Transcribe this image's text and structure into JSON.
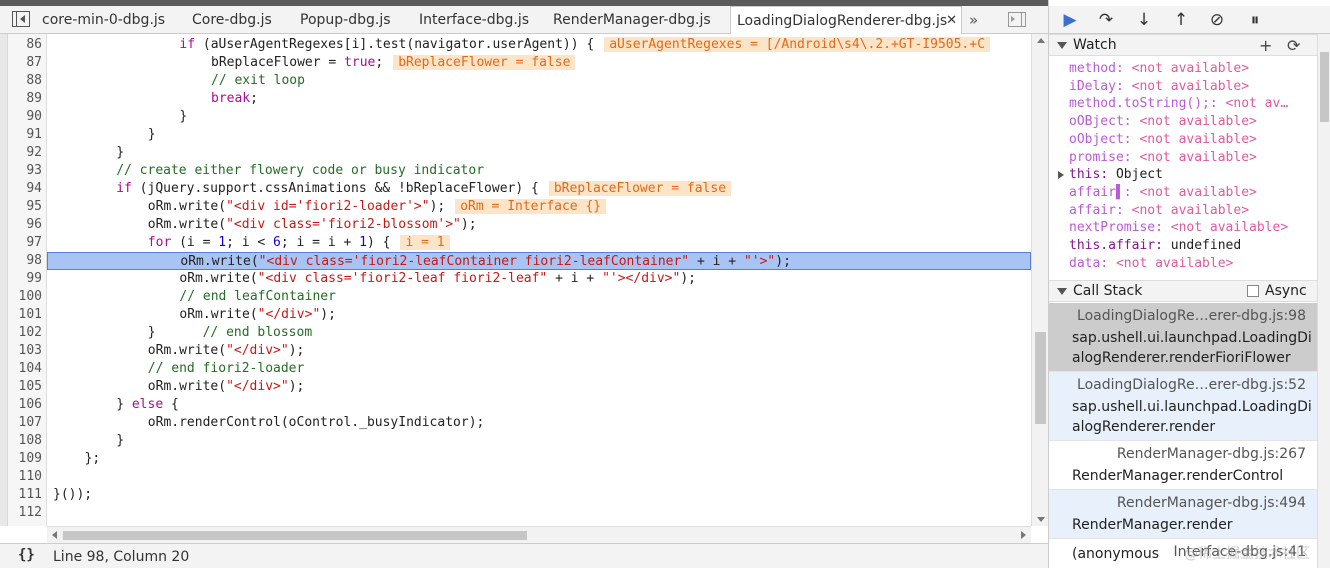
{
  "tabs": [
    {
      "label": "core-min-0-dbg.js",
      "active": false
    },
    {
      "label": "Core-dbg.js",
      "active": false
    },
    {
      "label": "Popup-dbg.js",
      "active": false
    },
    {
      "label": "Interface-dbg.js",
      "active": false
    },
    {
      "label": "RenderManager-dbg.js",
      "active": false
    },
    {
      "label": "LoadingDialogRenderer-dbg.js",
      "active": true
    }
  ],
  "tab_close_glyph": "✕",
  "tab_overflow_glyph": "»",
  "code_lines": [
    {
      "n": "86",
      "indent": 16,
      "tokens": [
        [
          "kw",
          "if"
        ],
        [
          "",
          " (aUserAgentRegexes[i].test(navigator.userAgent)) {"
        ]
      ],
      "inline": "aUserAgentRegexes = [/Android\\s4\\.2.+GT-I9505.+C"
    },
    {
      "n": "87",
      "indent": 20,
      "tokens": [
        [
          "",
          "bReplaceFlower = "
        ],
        [
          "kw",
          "true"
        ],
        [
          "",
          ";"
        ]
      ],
      "inline": "bReplaceFlower = false"
    },
    {
      "n": "88",
      "indent": 20,
      "tokens": [
        [
          "com",
          "// exit loop"
        ]
      ],
      "inline": ""
    },
    {
      "n": "89",
      "indent": 20,
      "tokens": [
        [
          "kw",
          "break"
        ],
        [
          "",
          ";"
        ]
      ],
      "inline": ""
    },
    {
      "n": "90",
      "indent": 16,
      "tokens": [
        [
          "",
          "}"
        ]
      ],
      "inline": ""
    },
    {
      "n": "91",
      "indent": 12,
      "tokens": [
        [
          "",
          "}"
        ]
      ],
      "inline": ""
    },
    {
      "n": "92",
      "indent": 8,
      "tokens": [
        [
          "",
          "}"
        ]
      ],
      "inline": ""
    },
    {
      "n": "93",
      "indent": 8,
      "tokens": [
        [
          "com",
          "// create either flowery code or busy indicator"
        ]
      ],
      "inline": ""
    },
    {
      "n": "94",
      "indent": 8,
      "tokens": [
        [
          "kw",
          "if"
        ],
        [
          "",
          " (jQuery.support.cssAnimations && !bReplaceFlower) {"
        ]
      ],
      "inline": "bReplaceFlower = false"
    },
    {
      "n": "95",
      "indent": 12,
      "tokens": [
        [
          "",
          "oRm.write("
        ],
        [
          "str",
          "\"<div id='fiori2-loader'>\""
        ],
        [
          "",
          ");"
        ]
      ],
      "inline": "oRm = Interface {}"
    },
    {
      "n": "96",
      "indent": 12,
      "tokens": [
        [
          "",
          "oRm.write("
        ],
        [
          "str",
          "\"<div class='fiori2-blossom'>\""
        ],
        [
          "",
          ");"
        ]
      ],
      "inline": ""
    },
    {
      "n": "97",
      "indent": 12,
      "tokens": [
        [
          "kw",
          "for"
        ],
        [
          "",
          " (i = "
        ],
        [
          "num",
          "1"
        ],
        [
          "",
          "; i < "
        ],
        [
          "num",
          "6"
        ],
        [
          "",
          "; i = i + "
        ],
        [
          "num",
          "1"
        ],
        [
          "",
          ") {"
        ]
      ],
      "inline": "i = 1"
    },
    {
      "n": "98",
      "indent": 16,
      "tokens": [
        [
          "",
          "oRm.write("
        ],
        [
          "str",
          "\"<div class='fiori2-leafContainer fiori2-leafContainer\""
        ],
        [
          "",
          " + i + "
        ],
        [
          "str",
          "\"'>\""
        ],
        [
          "",
          ");"
        ]
      ],
      "inline": "",
      "exec": true
    },
    {
      "n": "99",
      "indent": 16,
      "tokens": [
        [
          "",
          "oRm.write("
        ],
        [
          "str",
          "\"<div class='fiori2-leaf fiori2-leaf\""
        ],
        [
          "",
          " + i + "
        ],
        [
          "str",
          "\"'></div>\""
        ],
        [
          "",
          ");"
        ]
      ],
      "inline": ""
    },
    {
      "n": "100",
      "indent": 16,
      "tokens": [
        [
          "com",
          "// end leafContainer"
        ]
      ],
      "inline": ""
    },
    {
      "n": "101",
      "indent": 16,
      "tokens": [
        [
          "",
          "oRm.write("
        ],
        [
          "str",
          "\"</div>\""
        ],
        [
          "",
          ");"
        ]
      ],
      "inline": ""
    },
    {
      "n": "102",
      "indent": 12,
      "tokens": [
        [
          "",
          "}      "
        ],
        [
          "com",
          "// end blossom"
        ]
      ],
      "inline": ""
    },
    {
      "n": "103",
      "indent": 12,
      "tokens": [
        [
          "",
          "oRm.write("
        ],
        [
          "str",
          "\"</div>\""
        ],
        [
          "",
          ");"
        ]
      ],
      "inline": ""
    },
    {
      "n": "104",
      "indent": 12,
      "tokens": [
        [
          "com",
          "// end fiori2-loader"
        ]
      ],
      "inline": ""
    },
    {
      "n": "105",
      "indent": 12,
      "tokens": [
        [
          "",
          "oRm.write("
        ],
        [
          "str",
          "\"</div>\""
        ],
        [
          "",
          ");"
        ]
      ],
      "inline": ""
    },
    {
      "n": "106",
      "indent": 8,
      "tokens": [
        [
          "",
          "} "
        ],
        [
          "kw",
          "else"
        ],
        [
          "",
          " {"
        ]
      ],
      "inline": ""
    },
    {
      "n": "107",
      "indent": 12,
      "tokens": [
        [
          "",
          "oRm.renderControl(oControl._busyIndicator);"
        ]
      ],
      "inline": ""
    },
    {
      "n": "108",
      "indent": 8,
      "tokens": [
        [
          "",
          "}"
        ]
      ],
      "inline": ""
    },
    {
      "n": "109",
      "indent": 4,
      "tokens": [
        [
          "",
          "};"
        ]
      ],
      "inline": ""
    },
    {
      "n": "110",
      "indent": 0,
      "tokens": [],
      "inline": ""
    },
    {
      "n": "111",
      "indent": 0,
      "tokens": [
        [
          "",
          "}());"
        ]
      ],
      "inline": ""
    },
    {
      "n": "112",
      "indent": 0,
      "tokens": [],
      "inline": ""
    }
  ],
  "status": {
    "pretty_print": "{}",
    "cursor": "Line 98, Column 20"
  },
  "debugger_toolbar": [
    {
      "name": "resume-icon",
      "glyph": "▶"
    },
    {
      "name": "step-over-icon",
      "glyph": "↷"
    },
    {
      "name": "step-into-icon",
      "glyph": "↓"
    },
    {
      "name": "step-out-icon",
      "glyph": "↑"
    },
    {
      "name": "deactivate-breakpoints-icon",
      "glyph": "⊘"
    },
    {
      "name": "pause-on-exceptions-icon",
      "glyph": "⏸"
    }
  ],
  "watch": {
    "title": "Watch",
    "add_glyph": "+",
    "refresh_glyph": "⟳",
    "items": [
      {
        "name": "method",
        "value": "<not available>",
        "kind": "na"
      },
      {
        "name": "iDelay",
        "value": "<not available>",
        "kind": "na"
      },
      {
        "name": "method.toString();",
        "value": "<not av…",
        "kind": "na"
      },
      {
        "name": "oOBject",
        "value": "<not available>",
        "kind": "na"
      },
      {
        "name": "oObject",
        "value": "<not available>",
        "kind": "na"
      },
      {
        "name": "promise",
        "value": "<not available>",
        "kind": "na"
      },
      {
        "name": "this",
        "value": "Object",
        "kind": "obj",
        "expandable": true
      },
      {
        "name": "affair▌",
        "value": "<not available>",
        "kind": "na"
      },
      {
        "name": "affair",
        "value": "<not available>",
        "kind": "na"
      },
      {
        "name": "nextPromise",
        "value": "<not available>",
        "kind": "na"
      },
      {
        "name": "this.affair",
        "value": "undefined",
        "kind": "obj"
      },
      {
        "name": "data",
        "value": "<not available>",
        "kind": "na"
      }
    ]
  },
  "callstack": {
    "title": "Call Stack",
    "async_label": "Async",
    "frames": [
      {
        "location": "LoadingDialogRe…erer-dbg.js:98",
        "function": "sap.ushell.ui.launchpad.LoadingDialogRenderer.renderFioriFlower",
        "style": "selected"
      },
      {
        "location": "LoadingDialogRe…erer-dbg.js:52",
        "function": "sap.ushell.ui.launchpad.LoadingDialogRenderer.render",
        "style": "alt"
      },
      {
        "location": "RenderManager-dbg.js:267",
        "function": "RenderManager.renderControl",
        "style": "plain"
      },
      {
        "location": "RenderManager-dbg.js:494",
        "function": "RenderManager.render",
        "style": "alt"
      },
      {
        "location": "Interface-dbg.js:41",
        "function": "(anonymous",
        "style": "plain"
      }
    ]
  },
  "watermark": "@稀土掘金技术社区",
  "colors": {
    "exec_line": "#a8c4f5",
    "inline_value_bg": "#fce4c8",
    "selected_frame": "#cccccc"
  }
}
